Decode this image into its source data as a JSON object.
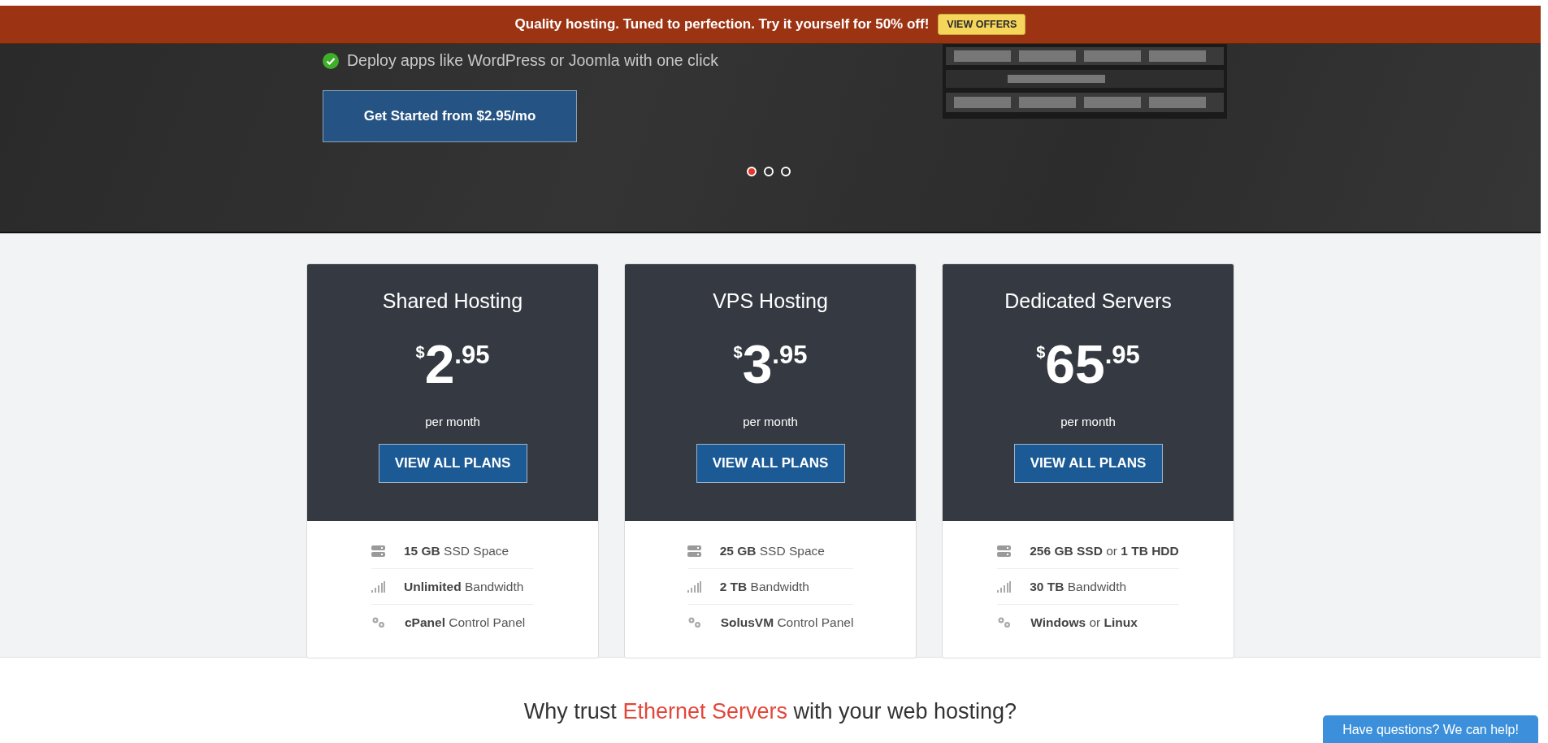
{
  "promo_banner": {
    "text": "Quality hosting. Tuned to perfection. Try it yourself for 50% off!",
    "button": "VIEW OFFERS"
  },
  "hero": {
    "feature": "Deploy apps like WordPress or Joomla with one click",
    "button": "Get Started from $2.95/mo",
    "slides": [
      {
        "selected": true
      },
      {
        "selected": false
      },
      {
        "selected": false
      }
    ]
  },
  "plans": [
    {
      "title": "Shared Hosting",
      "currency": "$",
      "price": "2",
      "cents": ".95",
      "period": "per month",
      "button": "VIEW ALL PLANS",
      "features": [
        {
          "kind": "storage",
          "text": "**15 GB** SSD Space"
        },
        {
          "kind": "bandwidth",
          "text": "**Unlimited** Bandwidth"
        },
        {
          "kind": "software",
          "text": "**cPanel** Control Panel"
        }
      ]
    },
    {
      "title": "VPS Hosting",
      "currency": "$",
      "price": "3",
      "cents": ".95",
      "period": "per month",
      "button": "VIEW ALL PLANS",
      "features": [
        {
          "kind": "storage",
          "text": "**25 GB** SSD Space"
        },
        {
          "kind": "bandwidth",
          "text": "**2 TB** Bandwidth"
        },
        {
          "kind": "software",
          "text": "**SolusVM** Control Panel"
        }
      ]
    },
    {
      "title": "Dedicated Servers",
      "currency": "$",
      "price": "65",
      "cents": ".95",
      "period": "per month",
      "button": "VIEW ALL PLANS",
      "features": [
        {
          "kind": "storage",
          "text": "**256 GB SSD** or **1 TB HDD**"
        },
        {
          "kind": "bandwidth",
          "text": "**30 TB** Bandwidth"
        },
        {
          "kind": "software",
          "text": "**Windows** or **Linux**"
        }
      ]
    }
  ],
  "trust_heading": {
    "before": "Why trust ",
    "brand": "Ethernet Servers",
    "after": " with your web hosting?"
  },
  "chat_button": "Have questions? We can help!"
}
